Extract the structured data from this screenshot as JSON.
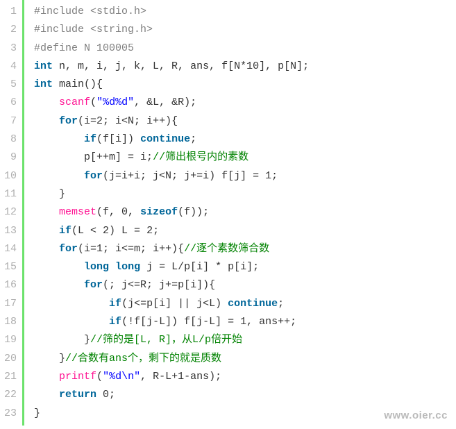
{
  "chart_data": {
    "type": "table",
    "title": "C code listing: segmented prime sieve",
    "language": "c"
  },
  "watermark": "www.oier.cc",
  "lines": [
    {
      "n": "1",
      "indent": 0,
      "tokens": [
        {
          "t": "#include <stdio.h>",
          "c": "pp"
        }
      ]
    },
    {
      "n": "2",
      "indent": 0,
      "tokens": [
        {
          "t": "#include <string.h>",
          "c": "pp"
        }
      ]
    },
    {
      "n": "3",
      "indent": 0,
      "tokens": [
        {
          "t": "#define N 100005",
          "c": "pp"
        }
      ]
    },
    {
      "n": "4",
      "indent": 0,
      "tokens": [
        {
          "t": "int",
          "c": "kw"
        },
        {
          "t": " n, m, i, j, k, L, R, ans, f[N*10], p[N];",
          "c": "plain"
        }
      ]
    },
    {
      "n": "5",
      "indent": 0,
      "tokens": [
        {
          "t": "int",
          "c": "kw"
        },
        {
          "t": " main(){",
          "c": "plain"
        }
      ]
    },
    {
      "n": "6",
      "indent": 1,
      "tokens": [
        {
          "t": "scanf",
          "c": "fn"
        },
        {
          "t": "(",
          "c": "plain"
        },
        {
          "t": "\"%d%d\"",
          "c": "str"
        },
        {
          "t": ", &L, &R);",
          "c": "plain"
        }
      ]
    },
    {
      "n": "7",
      "indent": 1,
      "tokens": [
        {
          "t": "for",
          "c": "kw"
        },
        {
          "t": "(i=2; i<N; i++){",
          "c": "plain"
        }
      ]
    },
    {
      "n": "8",
      "indent": 2,
      "tokens": [
        {
          "t": "if",
          "c": "kw"
        },
        {
          "t": "(f[i]) ",
          "c": "plain"
        },
        {
          "t": "continue",
          "c": "kw"
        },
        {
          "t": ";",
          "c": "plain"
        }
      ]
    },
    {
      "n": "9",
      "indent": 2,
      "tokens": [
        {
          "t": "p[++m] = i;",
          "c": "plain"
        },
        {
          "t": "//筛出根号内的素数",
          "c": "cmt"
        }
      ]
    },
    {
      "n": "10",
      "indent": 2,
      "tokens": [
        {
          "t": "for",
          "c": "kw"
        },
        {
          "t": "(j=i+i; j<N; j+=i) f[j] = 1;",
          "c": "plain"
        }
      ]
    },
    {
      "n": "11",
      "indent": 1,
      "tokens": [
        {
          "t": "}",
          "c": "plain"
        }
      ]
    },
    {
      "n": "12",
      "indent": 1,
      "tokens": [
        {
          "t": "memset",
          "c": "fn"
        },
        {
          "t": "(f, 0, ",
          "c": "plain"
        },
        {
          "t": "sizeof",
          "c": "kw"
        },
        {
          "t": "(f));",
          "c": "plain"
        }
      ]
    },
    {
      "n": "13",
      "indent": 1,
      "tokens": [
        {
          "t": "if",
          "c": "kw"
        },
        {
          "t": "(L < 2) L = 2;",
          "c": "plain"
        }
      ]
    },
    {
      "n": "14",
      "indent": 1,
      "tokens": [
        {
          "t": "for",
          "c": "kw"
        },
        {
          "t": "(i=1; i<=m; i++){",
          "c": "plain"
        },
        {
          "t": "//逐个素数筛合数",
          "c": "cmt"
        }
      ]
    },
    {
      "n": "15",
      "indent": 2,
      "tokens": [
        {
          "t": "long",
          "c": "kw"
        },
        {
          "t": " ",
          "c": "plain"
        },
        {
          "t": "long",
          "c": "kw"
        },
        {
          "t": " j = L/p[i] * p[i];",
          "c": "plain"
        }
      ]
    },
    {
      "n": "16",
      "indent": 2,
      "tokens": [
        {
          "t": "for",
          "c": "kw"
        },
        {
          "t": "(; j<=R; j+=p[i]){",
          "c": "plain"
        }
      ]
    },
    {
      "n": "17",
      "indent": 3,
      "tokens": [
        {
          "t": "if",
          "c": "kw"
        },
        {
          "t": "(j<=p[i] || j<L) ",
          "c": "plain"
        },
        {
          "t": "continue",
          "c": "kw"
        },
        {
          "t": ";",
          "c": "plain"
        }
      ]
    },
    {
      "n": "18",
      "indent": 3,
      "tokens": [
        {
          "t": "if",
          "c": "kw"
        },
        {
          "t": "(!f[j-L]) f[j-L] = 1, ans++;",
          "c": "plain"
        }
      ]
    },
    {
      "n": "19",
      "indent": 2,
      "tokens": [
        {
          "t": "}",
          "c": "plain"
        },
        {
          "t": "//筛的是[L, R]，从L/p倍开始",
          "c": "cmt"
        }
      ]
    },
    {
      "n": "20",
      "indent": 1,
      "tokens": [
        {
          "t": "}",
          "c": "plain"
        },
        {
          "t": "//合数有ans个，剩下的就是质数",
          "c": "cmt"
        }
      ]
    },
    {
      "n": "21",
      "indent": 1,
      "tokens": [
        {
          "t": "printf",
          "c": "fn"
        },
        {
          "t": "(",
          "c": "plain"
        },
        {
          "t": "\"%d\\n\"",
          "c": "str"
        },
        {
          "t": ", R-L+1-ans);",
          "c": "plain"
        }
      ]
    },
    {
      "n": "22",
      "indent": 1,
      "tokens": [
        {
          "t": "return",
          "c": "kw"
        },
        {
          "t": " 0;",
          "c": "plain"
        }
      ]
    },
    {
      "n": "23",
      "indent": 0,
      "tokens": [
        {
          "t": "}",
          "c": "plain"
        }
      ]
    }
  ]
}
